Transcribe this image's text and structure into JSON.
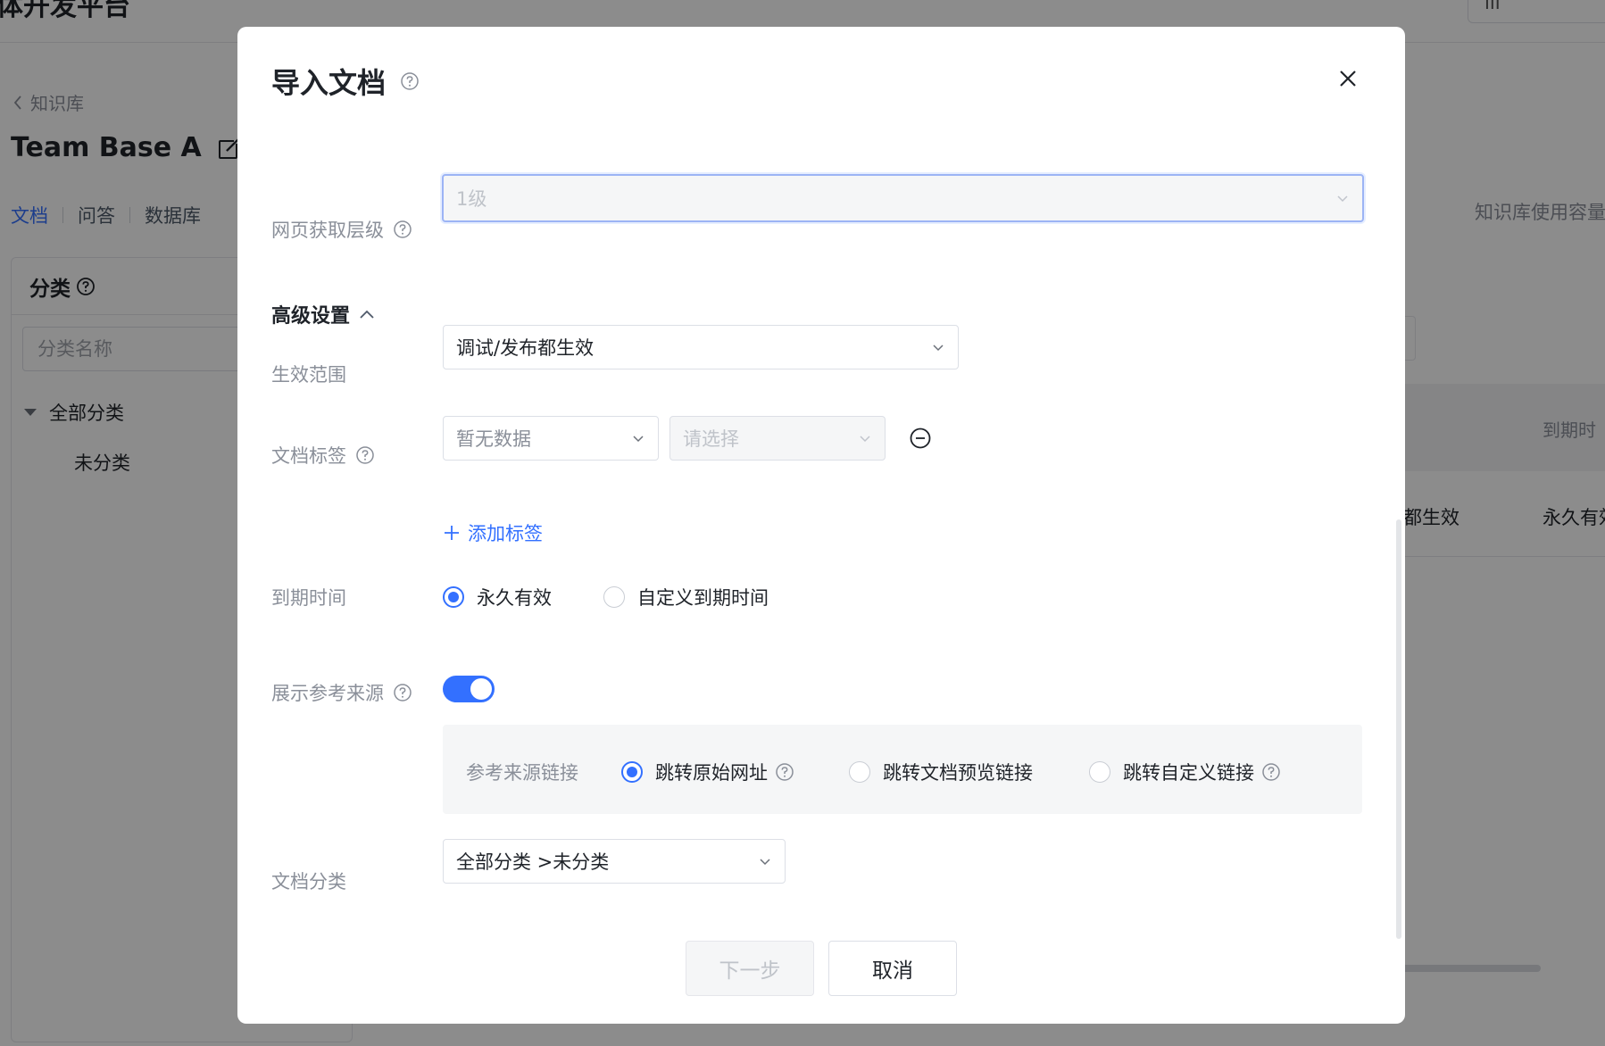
{
  "background": {
    "platform_title": "体开发平台",
    "top_right_text": "III",
    "back_label": "知识库",
    "kb_title": "Team Base A",
    "tabs": [
      {
        "label": "文档",
        "active": true
      },
      {
        "label": "问答",
        "active": false
      },
      {
        "label": "数据库",
        "active": false
      }
    ],
    "category": {
      "title": "分类",
      "search_placeholder": "分类名称",
      "all_label": "全部分类",
      "uncategorized_label": "未分类"
    },
    "usage_label": "知识库使用容量",
    "table_header_expiry": "到期时",
    "row_scope": "都生效",
    "row_expiry": "永久有效"
  },
  "modal": {
    "title": "导入文档",
    "crawl_level": {
      "label": "网页获取层级",
      "value": "1级"
    },
    "advanced_label": "高级设置",
    "scope": {
      "label": "生效范围",
      "value": "调试/发布都生效"
    },
    "doc_tags": {
      "label": "文档标签",
      "key_value": "暂无数据",
      "value_placeholder": "请选择",
      "add_label": "添加标签"
    },
    "expiry": {
      "label": "到期时间",
      "options": [
        {
          "label": "永久有效",
          "selected": true
        },
        {
          "label": "自定义到期时间",
          "selected": false
        }
      ]
    },
    "show_source": {
      "label": "展示参考来源",
      "enabled": true
    },
    "source_link": {
      "label": "参考来源链接",
      "options": [
        {
          "label": "跳转原始网址",
          "selected": true
        },
        {
          "label": "跳转文档预览链接",
          "selected": false
        },
        {
          "label": "跳转自定义链接",
          "selected": false
        }
      ]
    },
    "doc_category": {
      "label": "文档分类",
      "value": "全部分类 >未分类"
    },
    "buttons": {
      "next": "下一步",
      "cancel": "取消"
    }
  },
  "colors": {
    "accent": "#3370ff",
    "label_gray": "#8a8f99",
    "overlay": "rgba(0,0,0,0.45)"
  }
}
